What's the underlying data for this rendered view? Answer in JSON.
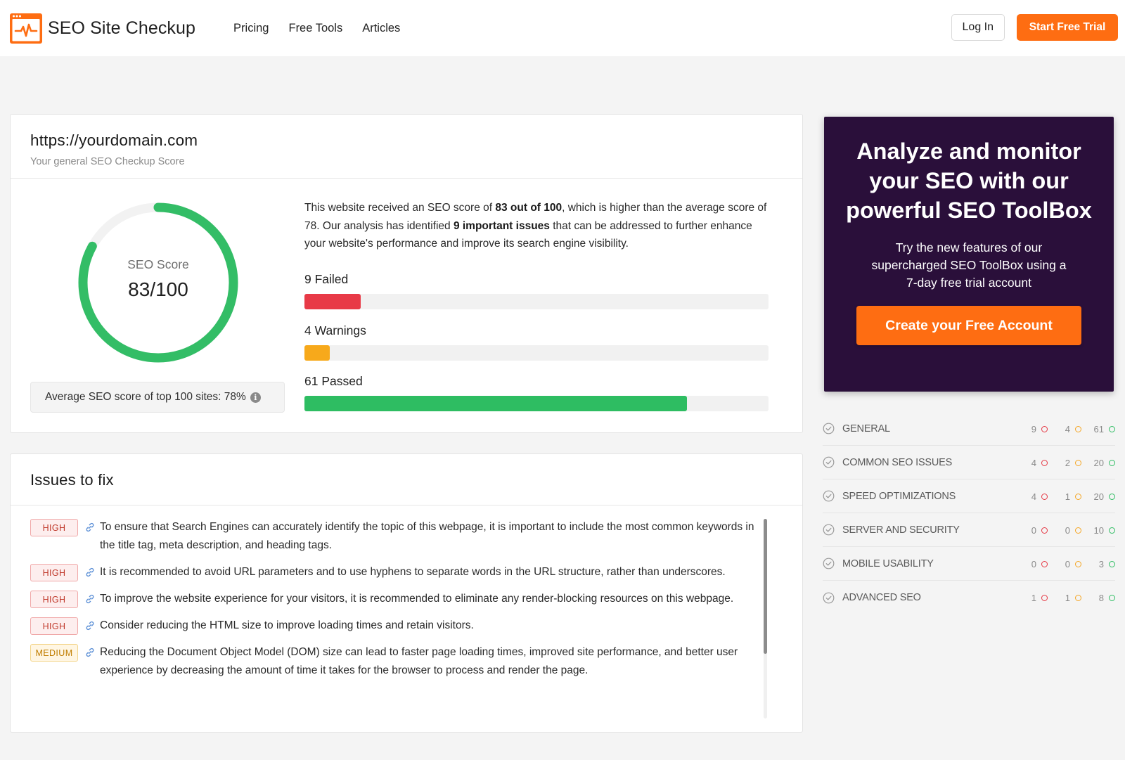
{
  "header": {
    "logo_text": "SEO Site Checkup",
    "nav": [
      "Pricing",
      "Free Tools",
      "Articles"
    ],
    "login_label": "Log In",
    "trial_label": "Start Free Trial",
    "accent_color": "#fe6d12"
  },
  "score_card": {
    "domain": "https://yourdomain.com",
    "subtitle": "Your general SEO Checkup Score",
    "gauge_label": "SEO Score",
    "gauge_value": "83/100",
    "score": 83,
    "score_max": 100,
    "avg_text": "Average SEO score of top 100 sites: 78%",
    "summary": {
      "p1": "This website received an SEO score of ",
      "b1": "83 out of 100",
      "p2": ", which is higher than the average score of 78. Our analysis has identified ",
      "b2": "9 important issues",
      "p3": " that can be addressed to further enhance your website's performance and improve its search engine visibility."
    },
    "stats": [
      {
        "count": "9",
        "label": "Failed",
        "value": 9,
        "color": "#e83a47"
      },
      {
        "count": "4",
        "label": "Warnings",
        "value": 4,
        "color": "#f7a91b"
      },
      {
        "count": "61",
        "label": "Passed",
        "value": 61,
        "color": "#2ebd62"
      }
    ],
    "stats_scale_max": 74
  },
  "issues": {
    "title": "Issues to fix",
    "items": [
      {
        "level": "HIGH",
        "text": "To ensure that Search Engines can accurately identify the topic of this webpage, it is important to include the most common keywords in the title tag, meta description, and heading tags."
      },
      {
        "level": "HIGH",
        "text": "It is recommended to avoid URL parameters and to use hyphens to separate words in the URL structure, rather than underscores."
      },
      {
        "level": "HIGH",
        "text": "To improve the website experience for your visitors, it is recommended to eliminate any render-blocking resources on this webpage."
      },
      {
        "level": "HIGH",
        "text": "Consider reducing the HTML size to improve loading times and retain visitors."
      },
      {
        "level": "MEDIUM",
        "text": "Reducing the Document Object Model (DOM) size can lead to faster page loading times, improved site performance, and better user experience by decreasing the amount of time it takes for the browser to process and render the page."
      }
    ]
  },
  "promo": {
    "title": "Analyze and monitor your SEO with our powerful SEO ToolBox",
    "text": "Try the new features of our supercharged SEO ToolBox using a 7-day free trial account",
    "button": "Create your Free Account",
    "bg_color": "#2a0f3a"
  },
  "categories": [
    {
      "name": "GENERAL",
      "failed": "9",
      "warnings": "4",
      "passed": "61"
    },
    {
      "name": "COMMON SEO ISSUES",
      "failed": "4",
      "warnings": "2",
      "passed": "20"
    },
    {
      "name": "SPEED OPTIMIZATIONS",
      "failed": "4",
      "warnings": "1",
      "passed": "20"
    },
    {
      "name": "SERVER AND SECURITY",
      "failed": "0",
      "warnings": "0",
      "passed": "10"
    },
    {
      "name": "MOBILE USABILITY",
      "failed": "0",
      "warnings": "0",
      "passed": "3"
    },
    {
      "name": "ADVANCED SEO",
      "failed": "1",
      "warnings": "1",
      "passed": "8"
    }
  ]
}
